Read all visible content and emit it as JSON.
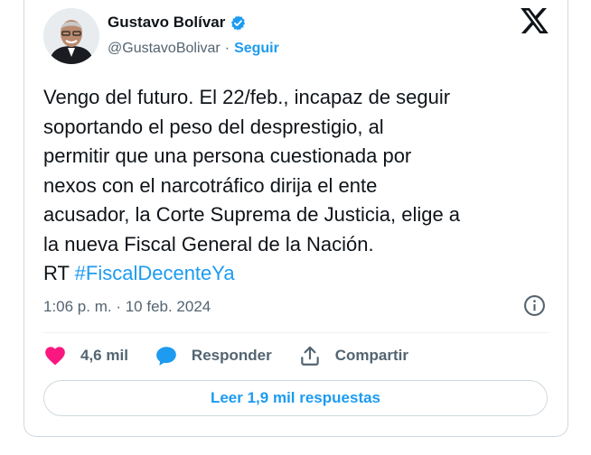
{
  "author": {
    "name": "Gustavo Bolívar",
    "handle": "@GustavoBolivar",
    "separator": "·",
    "follow_label": "Seguir"
  },
  "tweet": {
    "text": "Vengo del futuro. El 22/feb., incapaz de seguir\nsoportando el peso del desprestigio, al\npermitir que una persona cuestionada por\nnexos con el narcotráfico dirija el ente\nacusador, la Corte Suprema de Justicia, elige a\nla nueva Fiscal General de la Nación.\nRT ",
    "hashtag": "#FiscalDecenteYa"
  },
  "meta": {
    "time": "1:06 p. m.",
    "separator": " · ",
    "date": "10 feb. 2024"
  },
  "actions": {
    "likes_count": "4,6 mil",
    "reply_label": "Responder",
    "share_label": "Compartir"
  },
  "replies_button_label": "Leer 1,9 mil respuestas",
  "colors": {
    "accent": "#1d9bf0",
    "like": "#f91880",
    "text": "#0f1419",
    "muted": "#536471",
    "border": "#cfd9de"
  },
  "icons": [
    "verified-badge-icon",
    "x-logo-icon",
    "info-icon",
    "heart-icon",
    "reply-bubble-icon",
    "share-icon"
  ]
}
